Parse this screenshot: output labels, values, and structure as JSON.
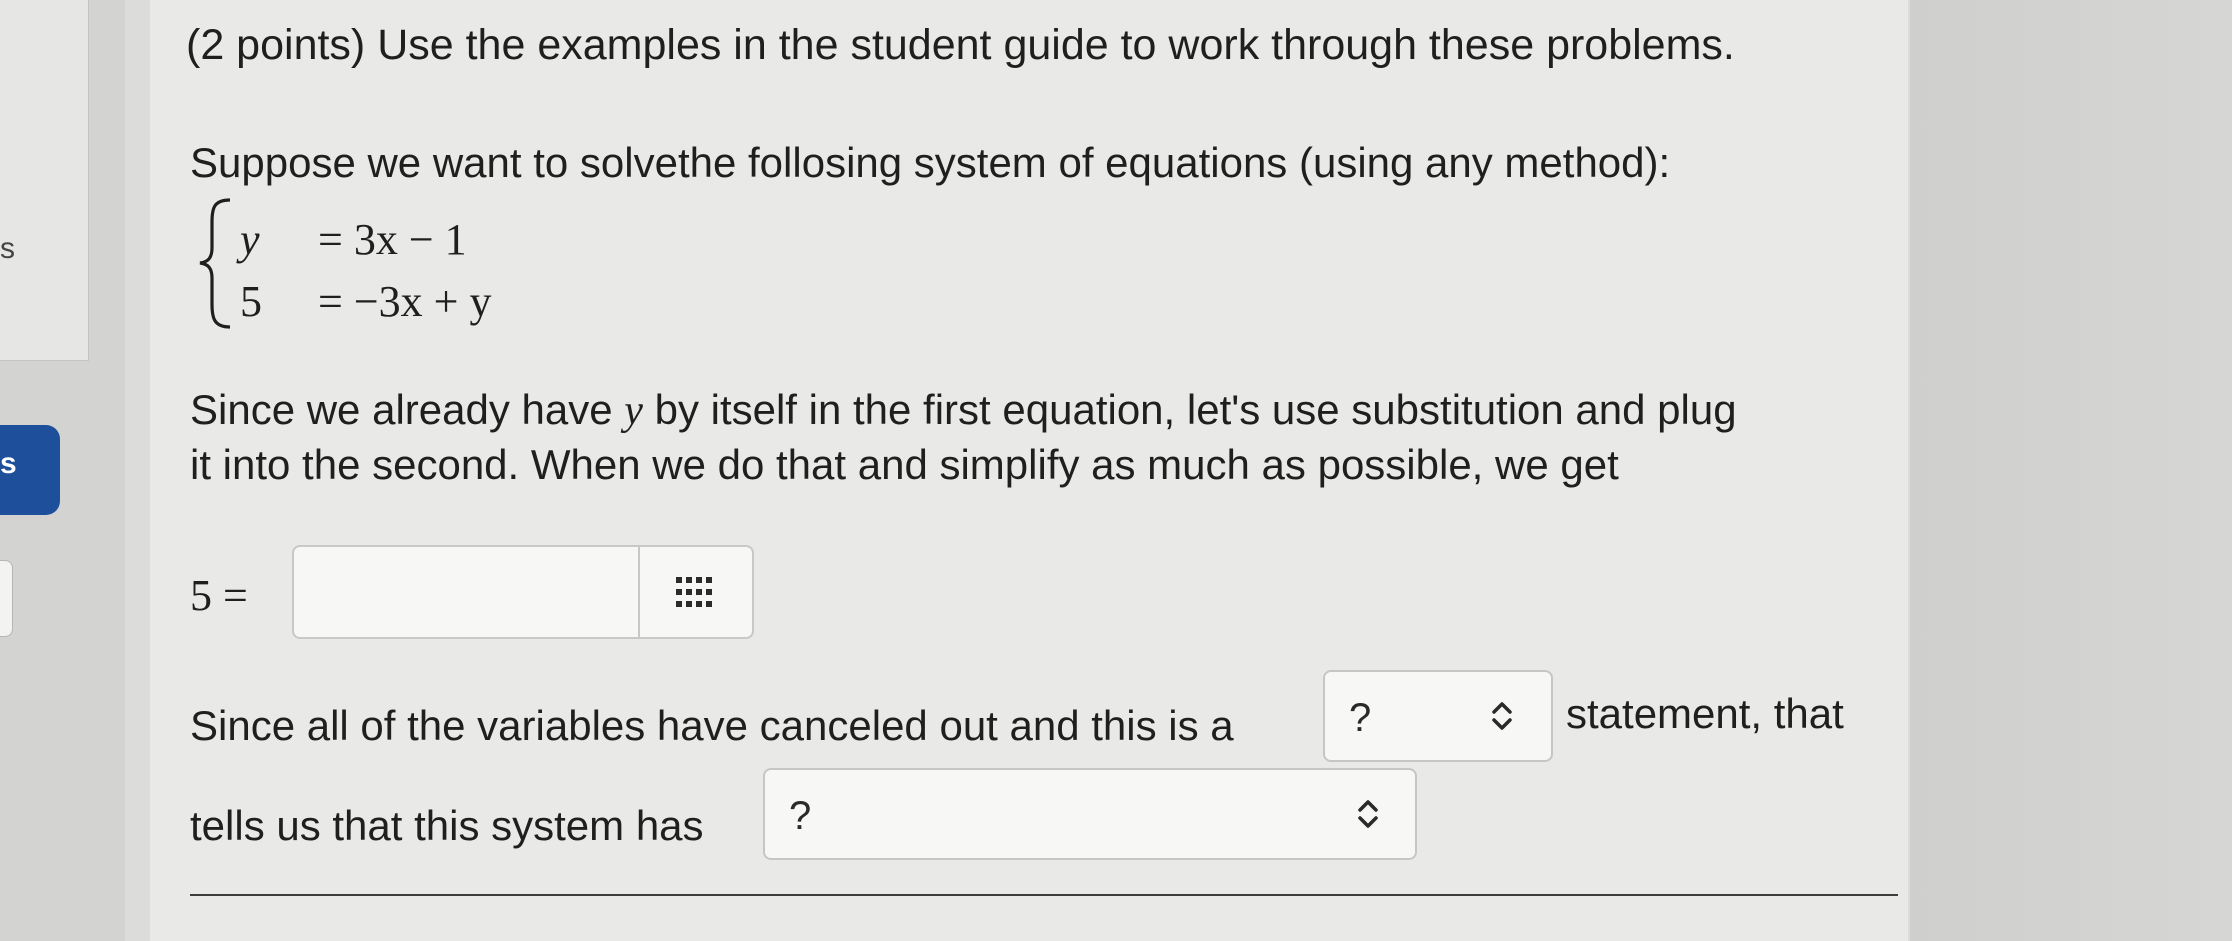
{
  "sidebar": {
    "top_letter": "s",
    "badge_letter": "s"
  },
  "question": {
    "header": "(2 points) Use the examples in the student guide to work through these problems.",
    "intro": "Suppose we want to solvethe follosing system of equations (using any method):",
    "system": [
      {
        "lhs": "y",
        "rhs": "= 3x − 1"
      },
      {
        "lhs": "5",
        "rhs": "= −3x + y"
      }
    ],
    "para1_line1_a": "Since we already have",
    "para1_var": "y",
    "para1_line1_b": "by itself in the first equation, let's use substitution and plug",
    "para1_line2": "it into the second. When we do that and simplify as much as possible, we get",
    "answer_prefix": "5 =",
    "answer_value": "",
    "keypad_icon": "keypad-grid-icon",
    "para2_a": "Since all of the variables have canceled out and this is a",
    "select1_value": "?",
    "para2_b": "statement, that",
    "para3_a": "tells us that this system has",
    "select2_value": "?"
  },
  "colors": {
    "badge": "#1d4f9a",
    "card": "#e9e9e7",
    "text": "#1f1f1f"
  }
}
